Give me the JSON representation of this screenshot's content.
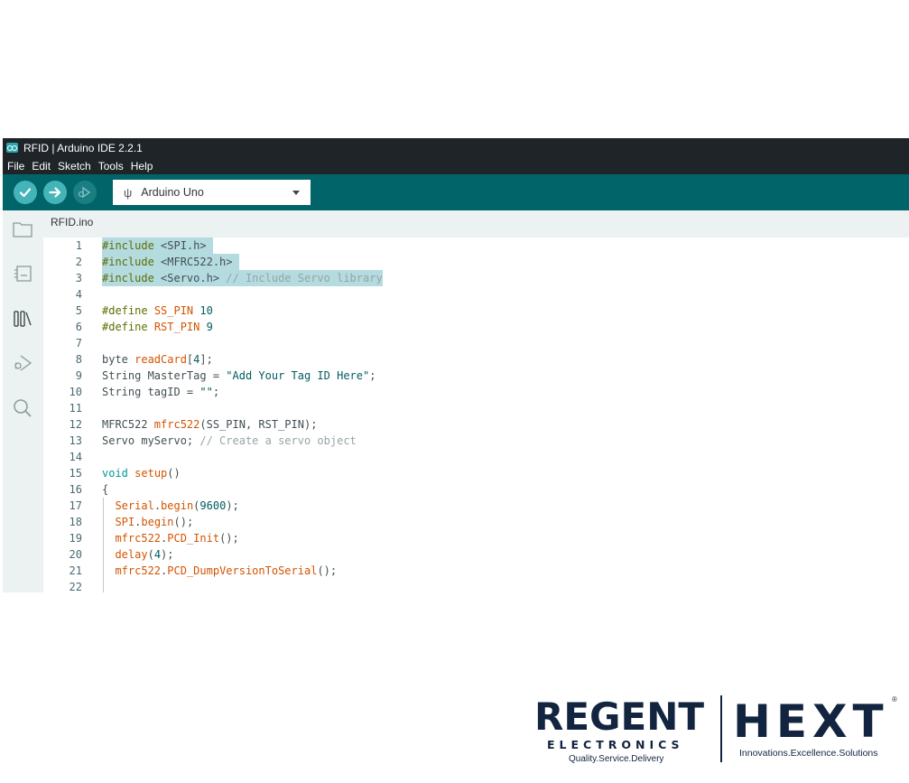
{
  "window": {
    "title": "RFID | Arduino IDE 2.2.1"
  },
  "menu": [
    "File",
    "Edit",
    "Sketch",
    "Tools",
    "Help"
  ],
  "toolbar": {
    "board": "Arduino Uno",
    "accent": "#006468"
  },
  "sidebar": {
    "icons": [
      "folder-icon",
      "board-icon",
      "library-icon",
      "debug-icon",
      "search-icon"
    ]
  },
  "editor": {
    "tab": "RFID.ino",
    "lines": [
      {
        "n": "1",
        "code": "#include <SPI.h> "
      },
      {
        "n": "2",
        "code": "#include <MFRC522.h> "
      },
      {
        "n": "3",
        "code": "#include <Servo.h> // Include Servo library"
      },
      {
        "n": "4",
        "code": ""
      },
      {
        "n": "5",
        "code": "#define SS_PIN 10"
      },
      {
        "n": "6",
        "code": "#define RST_PIN 9"
      },
      {
        "n": "7",
        "code": ""
      },
      {
        "n": "8",
        "code": "byte readCard[4];"
      },
      {
        "n": "9",
        "code": "String MasterTag = \"Add Your Tag ID Here\";"
      },
      {
        "n": "10",
        "code": "String tagID = \"\";"
      },
      {
        "n": "11",
        "code": ""
      },
      {
        "n": "12",
        "code": "MFRC522 mfrc522(SS_PIN, RST_PIN);"
      },
      {
        "n": "13",
        "code": "Servo myServo; // Create a servo object"
      },
      {
        "n": "14",
        "code": ""
      },
      {
        "n": "15",
        "code": "void setup()"
      },
      {
        "n": "16",
        "code": "{"
      },
      {
        "n": "17",
        "code": "  Serial.begin(9600);"
      },
      {
        "n": "18",
        "code": "  SPI.begin();"
      },
      {
        "n": "19",
        "code": "  mfrc522.PCD_Init();"
      },
      {
        "n": "20",
        "code": "  delay(4);"
      },
      {
        "n": "21",
        "code": "  mfrc522.PCD_DumpVersionToSerial();"
      },
      {
        "n": "22",
        "code": ""
      }
    ]
  },
  "logos": {
    "regent": {
      "word": "REGENT",
      "sub": "ELECTRONICS",
      "tagline": "Quality.Service.Delivery"
    },
    "hext": {
      "word": "HEXT",
      "reg": "®",
      "tagline": "Innovations.Excellence.Solutions"
    }
  }
}
